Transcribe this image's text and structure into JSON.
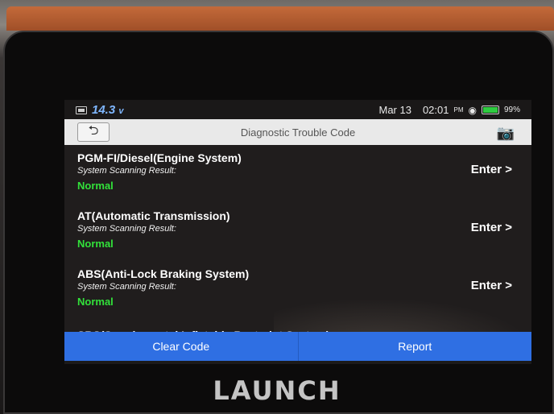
{
  "status": {
    "voltage": "14.3",
    "voltage_unit": "v",
    "date": "Mar 13",
    "time": "02:01",
    "ampm": "PM",
    "battery_pct": "99%"
  },
  "header": {
    "title": "Diagnostic Trouble Code"
  },
  "systems": [
    {
      "name": "PGM-FI/Diesel(Engine System)",
      "sub": "System Scanning Result:",
      "result": "Normal",
      "action": "Enter >"
    },
    {
      "name": "AT(Automatic Transmission)",
      "sub": "System Scanning Result:",
      "result": "Normal",
      "action": "Enter >"
    },
    {
      "name": "ABS(Anti-Lock Braking System)",
      "sub": "System Scanning Result:",
      "result": "Normal",
      "action": "Enter >"
    }
  ],
  "partial_item": "SRS(Supplemental Inflatable Restraint System)",
  "footer": {
    "clear_label": "Clear Code",
    "report_label": "Report"
  },
  "brand": "LAUNCH",
  "colors": {
    "accent": "#2f6fe3",
    "normal": "#32e13a"
  }
}
